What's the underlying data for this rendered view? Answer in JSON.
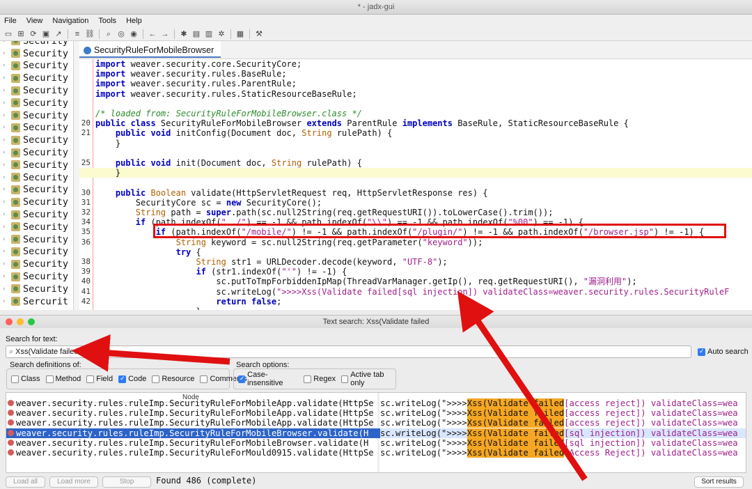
{
  "window": {
    "title": "* - jadx-gui"
  },
  "menu": [
    "File",
    "View",
    "Navigation",
    "Tools",
    "Help"
  ],
  "toolbar_icons": [
    "open-icon",
    "add-file-icon",
    "sync-icon",
    "save-icon",
    "export-icon",
    "sep",
    "flatten-icon",
    "link-icon",
    "sep",
    "search-icon",
    "find-class-icon",
    "find-usage-icon",
    "sep",
    "back-icon",
    "forward-icon",
    "sep",
    "quark-icon",
    "deobf-icon",
    "log-icon",
    "debug-icon",
    "sep",
    "log-viewer-icon",
    "sep",
    "preferences-icon"
  ],
  "sidebar": {
    "items": [
      "Security",
      "Security",
      "Security",
      "Security",
      "Security",
      "Security",
      "Security",
      "Security",
      "Security",
      "Security",
      "Security",
      "Security",
      "Security",
      "Security",
      "Security",
      "Security",
      "Security",
      "Security",
      "Security",
      "Security",
      "Security",
      "Sercurit"
    ]
  },
  "editor": {
    "tab_label": "SecurityRuleForMobileBrowser",
    "lines": [
      {
        "ln": "",
        "html": "<span class='kw'>import</span> weaver.security.core.SecurityCore;"
      },
      {
        "ln": "",
        "html": "<span class='kw'>import</span> weaver.security.rules.BaseRule;"
      },
      {
        "ln": "",
        "html": "<span class='kw'>import</span> weaver.security.rules.ParentRule;"
      },
      {
        "ln": "",
        "html": "<span class='kw'>import</span> weaver.security.rules.StaticResourceBaseRule;"
      },
      {
        "ln": "",
        "html": ""
      },
      {
        "ln": "",
        "html": "<span class='cm'>/* loaded from: SecurityRuleForMobileBrowser.class */</span>"
      },
      {
        "ln": "20",
        "html": "<span class='kw'>public class</span> SecurityRuleForMobileBrowser <span class='kw'>extends</span> ParentRule <span class='kw'>implements</span> BaseRule, StaticResourceBaseRule {"
      },
      {
        "ln": "21",
        "html": "    <span class='kw'>public void</span> initConfig(Document doc, <span class='ty'>String</span> rulePath) {"
      },
      {
        "ln": "",
        "html": "    }"
      },
      {
        "ln": "",
        "html": ""
      },
      {
        "ln": "25",
        "html": "    <span class='kw'>public void</span> init(Document doc, <span class='ty'>String</span> rulePath) {"
      },
      {
        "ln": "",
        "html": "    }",
        "hl": true
      },
      {
        "ln": "",
        "html": ""
      },
      {
        "ln": "30",
        "html": "    <span class='kw'>public</span> <span class='ty'>Boolean</span> validate(HttpServletRequest req, HttpServletResponse res) {"
      },
      {
        "ln": "31",
        "html": "        SecurityCore sc = <span class='kw'>new</span> SecurityCore();"
      },
      {
        "ln": "32",
        "html": "        <span class='ty'>String</span> path = <span class='kw'>super</span>.path(sc.null2String(req.getRequestURI()).toLowerCase().trim());"
      },
      {
        "ln": "34",
        "html": "        <span class='kw'>if</span> (path.indexOf(<span class='st'>\"../\"</span>) == -1 &amp;&amp; path.indexOf(<span class='st'>\"\\\\\"</span>) == -1 &amp;&amp; path.indexOf(<span class='st'>\"%00\"</span>) == -1) {"
      },
      {
        "ln": "35",
        "html": "            <span class='kw'>if</span> (path.indexOf(<span class='st'>\"/mobile/\"</span>) != -1 &amp;&amp; path.indexOf(<span class='st'>\"/plugin/\"</span>) != -1 &amp;&amp; path.indexOf(<span class='st'>\"/browser.jsp\"</span>) != -1) {"
      },
      {
        "ln": "36",
        "html": "                <span class='ty'>String</span> keyword = sc.null2String(req.getParameter(<span class='st'>\"keyword\"</span>));"
      },
      {
        "ln": "",
        "html": "                <span class='kw'>try</span> {"
      },
      {
        "ln": "38",
        "html": "                    <span class='ty'>String</span> str1 = URLDecoder.decode(keyword, <span class='st'>\"UTF-8\"</span>);"
      },
      {
        "ln": "39",
        "html": "                    <span class='kw'>if</span> (str1.indexOf(<span class='st'>\"'\"</span>) != -1) {"
      },
      {
        "ln": "40",
        "html": "                        sc.putToTmpForbiddenIpMap(ThreadVarManager.getIp(), req.getRequestURI(), <span class='st'>\"漏洞利用\"</span>);"
      },
      {
        "ln": "41",
        "html": "                        sc.writeLog(<span class='st'>\">>>>Xss(Validate failed[sql injection]) validateClass=weaver.security.rules.SecurityRuleF</span>"
      },
      {
        "ln": "42",
        "html": "                        <span class='kw'>return false</span>;"
      },
      {
        "ln": "",
        "html": "                    }"
      }
    ]
  },
  "dialog": {
    "title": "Text search: Xss(Validate failed",
    "search_label": "Search for text:",
    "search_value": "Xss(Validate failed",
    "auto_search_label": "Auto search",
    "auto_search_checked": true,
    "defs_label": "Search definitions of:",
    "defs": [
      {
        "label": "Class",
        "checked": false
      },
      {
        "label": "Method",
        "checked": false
      },
      {
        "label": "Field",
        "checked": false
      },
      {
        "label": "Code",
        "checked": true
      },
      {
        "label": "Resource",
        "checked": false
      },
      {
        "label": "Comments",
        "checked": false
      }
    ],
    "opts_label": "Search options:",
    "opts": [
      {
        "label": "Case-insensitive",
        "checked": true
      },
      {
        "label": "Regex",
        "checked": false
      },
      {
        "label": "Active tab only",
        "checked": false
      }
    ],
    "column_node": "Node",
    "results": [
      {
        "node": "weaver.security.rules.ruleImp.SecurityRuleForMobileApp.validate(HttpSe",
        "pre": "sc.writeLog(\">>>>",
        "match": "Xss(Validate failed",
        "post": "[access reject]) validateClass=wea",
        "selected": false
      },
      {
        "node": "weaver.security.rules.ruleImp.SecurityRuleForMobileApp.validate(HttpSe",
        "pre": "sc.writeLog(\">>>>",
        "match": "Xss(Validate failed",
        "post": "[access reject]) validateClass=wea",
        "selected": false
      },
      {
        "node": "weaver.security.rules.ruleImp.SecurityRuleForMobileApp.validate(HttpSe",
        "pre": "sc.writeLog(\">>>>",
        "match": "Xss(Validate failed",
        "post": "[access reject]) validateClass=wea",
        "selected": false
      },
      {
        "node": "weaver.security.rules.ruleImp.SecurityRuleForMobileBrowser.validate(H",
        "pre": "sc.writeLog(\">>>>",
        "match": "Xss(Validate failed",
        "post": "[sql injection]) validateClass=wea",
        "selected": true
      },
      {
        "node": "weaver.security.rules.ruleImp.SecurityRuleForMobileBrowser.validate(H",
        "pre": "sc.writeLog(\">>>>",
        "match": "Xss(Validate failed",
        "post": "[sql injection]) validateClass=wea",
        "selected": false
      },
      {
        "node": "weaver.security.rules.ruleImp.SecurityRuleForMould0915.validate(HttpSe",
        "pre": "sc.writeLog(\">>>>",
        "match": "Xss(Validate failed",
        "post": "[Access Reject]) validateClass=wea",
        "selected": false
      }
    ],
    "buttons": {
      "load_all": "Load all",
      "load_more": "Load more",
      "stop": "Stop",
      "sort": "Sort results"
    },
    "status": "Found 486 (complete)"
  },
  "colors": {
    "accent": "#2d63c8",
    "match_highlight": "#f5a623",
    "annotation_red": "#e01010"
  }
}
